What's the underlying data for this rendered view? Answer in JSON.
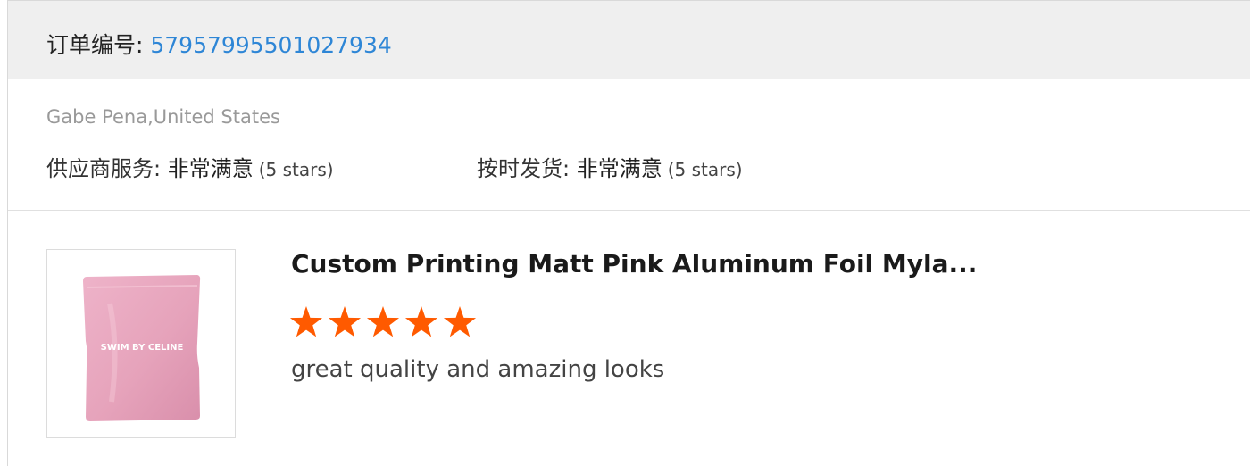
{
  "order": {
    "label": "订单编号: ",
    "number": "57957995501027934"
  },
  "buyer": "Gabe Pena,United States",
  "ratings": [
    {
      "label": "供应商服务: ",
      "value": "非常满意",
      "stars_text": "(5 stars)"
    },
    {
      "label": "按时发货: ",
      "value": "非常满意",
      "stars_text": "(5 stars)"
    }
  ],
  "product": {
    "title": "Custom Printing Matt Pink Aluminum Foil Myla...",
    "image_brand_text": "SWIM BY CELINE",
    "rating": 5,
    "rating_max": 5,
    "review": "great quality and amazing looks"
  },
  "colors": {
    "link": "#2e86d6",
    "star": "#ff5a00",
    "header_bg": "#efefef",
    "bag_pink": "#e7a5bd"
  }
}
